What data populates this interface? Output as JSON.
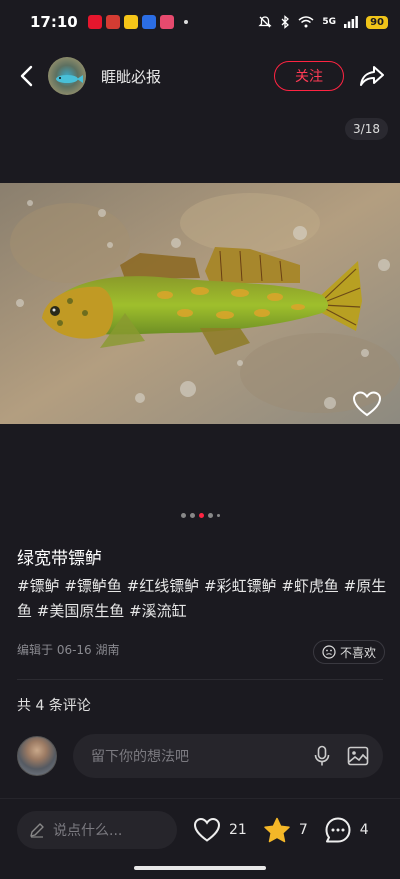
{
  "status_bar": {
    "time": "17:10",
    "network": "5G",
    "battery": "90"
  },
  "header": {
    "author": "睚眦必报",
    "follow_label": "关注"
  },
  "post": {
    "page_counter": "3/18",
    "title": "绿宽带镖鲈",
    "tags": "#镖鲈 #镖鲈鱼 #红线镖鲈 #彩虹镖鲈 #虾虎鱼 #原生鱼 #美国原生鱼 #溪流缸",
    "meta": "编辑于 06-16 湖南",
    "dislike_label": "不喜欢",
    "image_index": 3,
    "image_count": 18
  },
  "comments": {
    "count_label": "共 4 条评论",
    "input_placeholder": "留下你的想法吧"
  },
  "bottom_bar": {
    "say_placeholder": "说点什么...",
    "likes": "21",
    "stars": "7",
    "comments": "4"
  },
  "colors": {
    "accent": "#ff2442",
    "background": "#1b1a20",
    "star": "#f4b728"
  }
}
